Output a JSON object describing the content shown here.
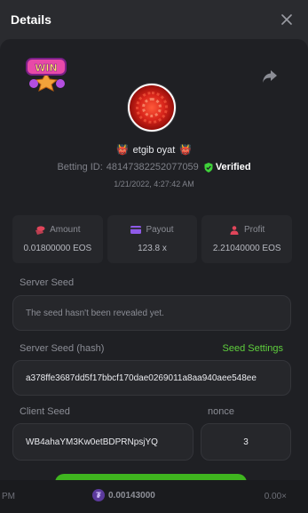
{
  "header": {
    "title": "Details"
  },
  "profile": {
    "badge_text": "WIN",
    "username": "etgib oyat",
    "betting_id_label": "Betting ID:",
    "betting_id": "48147382252077059",
    "verified_label": "Verified",
    "date": "1/21/2022, 4:27:42 AM"
  },
  "stats": [
    {
      "label": "Amount",
      "value": "0.01800000 EOS",
      "icon": "coins-icon",
      "color": "#e0455a"
    },
    {
      "label": "Payout",
      "value": "123.8 x",
      "icon": "card-icon",
      "color": "#8e5ae8"
    },
    {
      "label": "Profit",
      "value": "2.21040000 EOS",
      "icon": "people-icon",
      "color": "#e0455a"
    }
  ],
  "server_seed": {
    "label": "Server Seed",
    "value": "The seed hasn't been revealed yet."
  },
  "server_seed_hash": {
    "label": "Server Seed (hash)",
    "value": "a378ffe3687dd5f17bbcf170dae0269011a8aa940aee548ee"
  },
  "seed_settings_label": "Seed Settings",
  "client_seed": {
    "label": "Client Seed",
    "value": "WB4ahaYM3Kw0etBDPRNpsjYQ"
  },
  "nonce": {
    "label": "nonce",
    "value": "3"
  },
  "footer": {
    "left": "PM",
    "amount": "0.00143000",
    "mult": "0.00×",
    "coin_symbol": "₮"
  },
  "colors": {
    "accent_green": "#5fcf3d",
    "verified_green": "#3fd23a",
    "background": "#1f2024"
  }
}
